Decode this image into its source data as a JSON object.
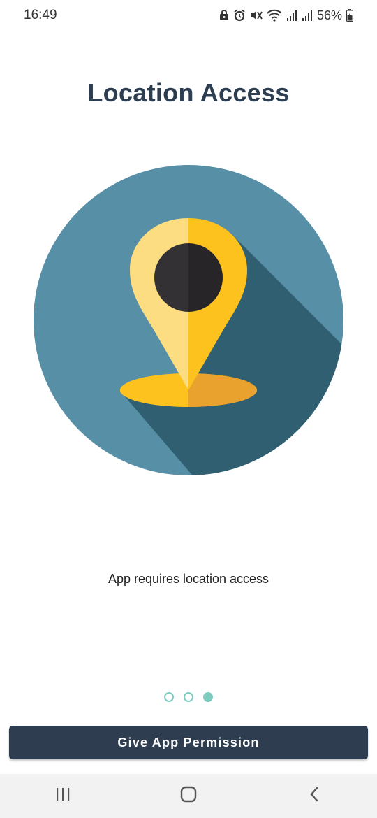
{
  "status_bar": {
    "time": "16:49",
    "battery_percent": "56%",
    "icons": [
      "lock-icon",
      "alarm-icon",
      "mute-icon",
      "wifi-icon",
      "signal-icon",
      "signal-icon",
      "battery-charging-icon"
    ]
  },
  "page": {
    "title": "Location Access",
    "description": "App requires location access"
  },
  "pager": {
    "total": 3,
    "active_index": 2
  },
  "button": {
    "label": "Give App Permission"
  },
  "nav_bar": {
    "icons": [
      "recent-apps-icon",
      "home-icon",
      "back-icon"
    ]
  },
  "colors": {
    "title": "#2c3e50",
    "button_bg": "#2e3d50",
    "pager_dot": "#7ecbc0",
    "circle_bg": "#568fa6",
    "circle_shadow": "#2f5f71",
    "pin_light": "#fddd81",
    "pin_dark": "#fdc21e",
    "pin_center": "#2b2a2c",
    "base_shadow": "#e9a22e"
  }
}
